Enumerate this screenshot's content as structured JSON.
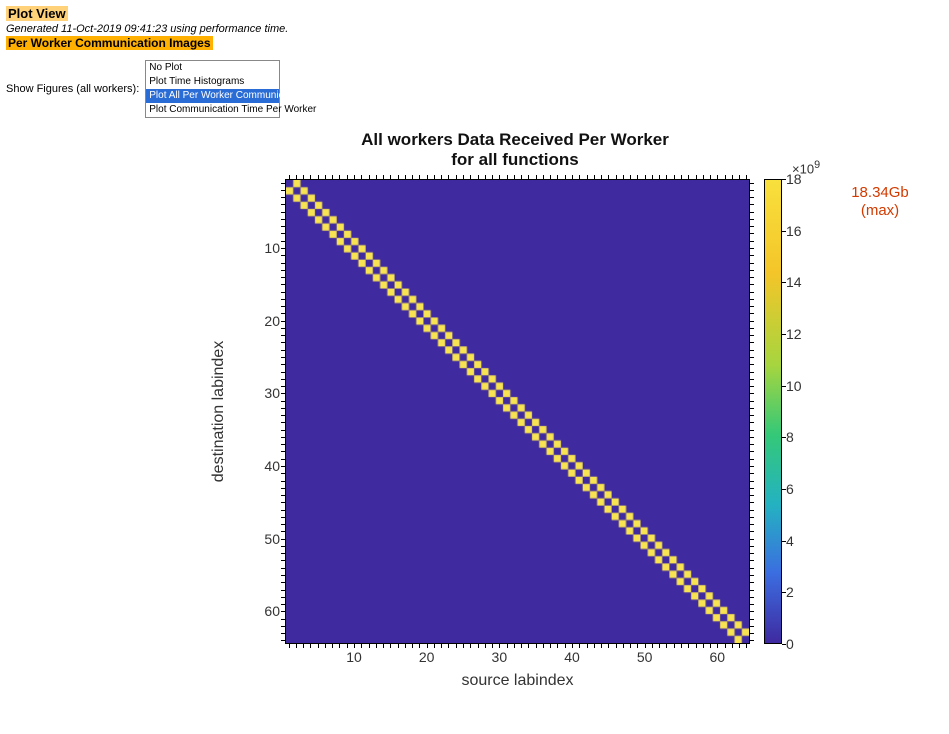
{
  "header": {
    "title": "Plot View",
    "generated": "Generated 11-Oct-2019 09:41:23 using performance time.",
    "subtitle": "Per Worker Communication Images"
  },
  "controls": {
    "label": "Show Figures (all workers):",
    "options": [
      {
        "label": "No Plot",
        "selected": false
      },
      {
        "label": "Plot Time Histograms",
        "selected": false
      },
      {
        "label": "Plot All Per Worker Communication",
        "selected": true
      },
      {
        "label": "Plot Communication Time Per Worker",
        "selected": false
      }
    ]
  },
  "chart": {
    "title_line1": "All workers Data Received Per Worker",
    "title_line2": "for all functions",
    "xlabel": "source labindex",
    "ylabel": "destination labindex",
    "xticks": [
      10,
      20,
      30,
      40,
      50,
      60
    ],
    "yticks": [
      10,
      20,
      30,
      40,
      50,
      60
    ],
    "annotation_value": "18.34Gb",
    "annotation_max": "(max)"
  },
  "colorbar": {
    "exponent": "×10",
    "exponent_sup": "9",
    "ticks": [
      0,
      2,
      4,
      6,
      8,
      10,
      12,
      14,
      16,
      18
    ]
  },
  "chart_data": {
    "type": "heatmap",
    "title": "All workers Data Received Per Worker for all functions",
    "xlabel": "source labindex",
    "ylabel": "destination labindex",
    "n": 64,
    "x_range": [
      1,
      64
    ],
    "y_range": [
      1,
      64
    ],
    "colorbar_range": [
      0,
      18000000000
    ],
    "colorbar_exponent": 9,
    "colormap": "parula",
    "annotation": "18.34Gb (max)",
    "description": "Square 64×64 matrix of bytes received by destination labindex (rows) from source labindex (columns). Cells where source == destination ± 1 (immediate neighbours) are at the maximum ~18.34×10^9; the main diagonal and all other cells are near 0.",
    "off_diagonal_value": 18340000000,
    "background_value": 0
  }
}
